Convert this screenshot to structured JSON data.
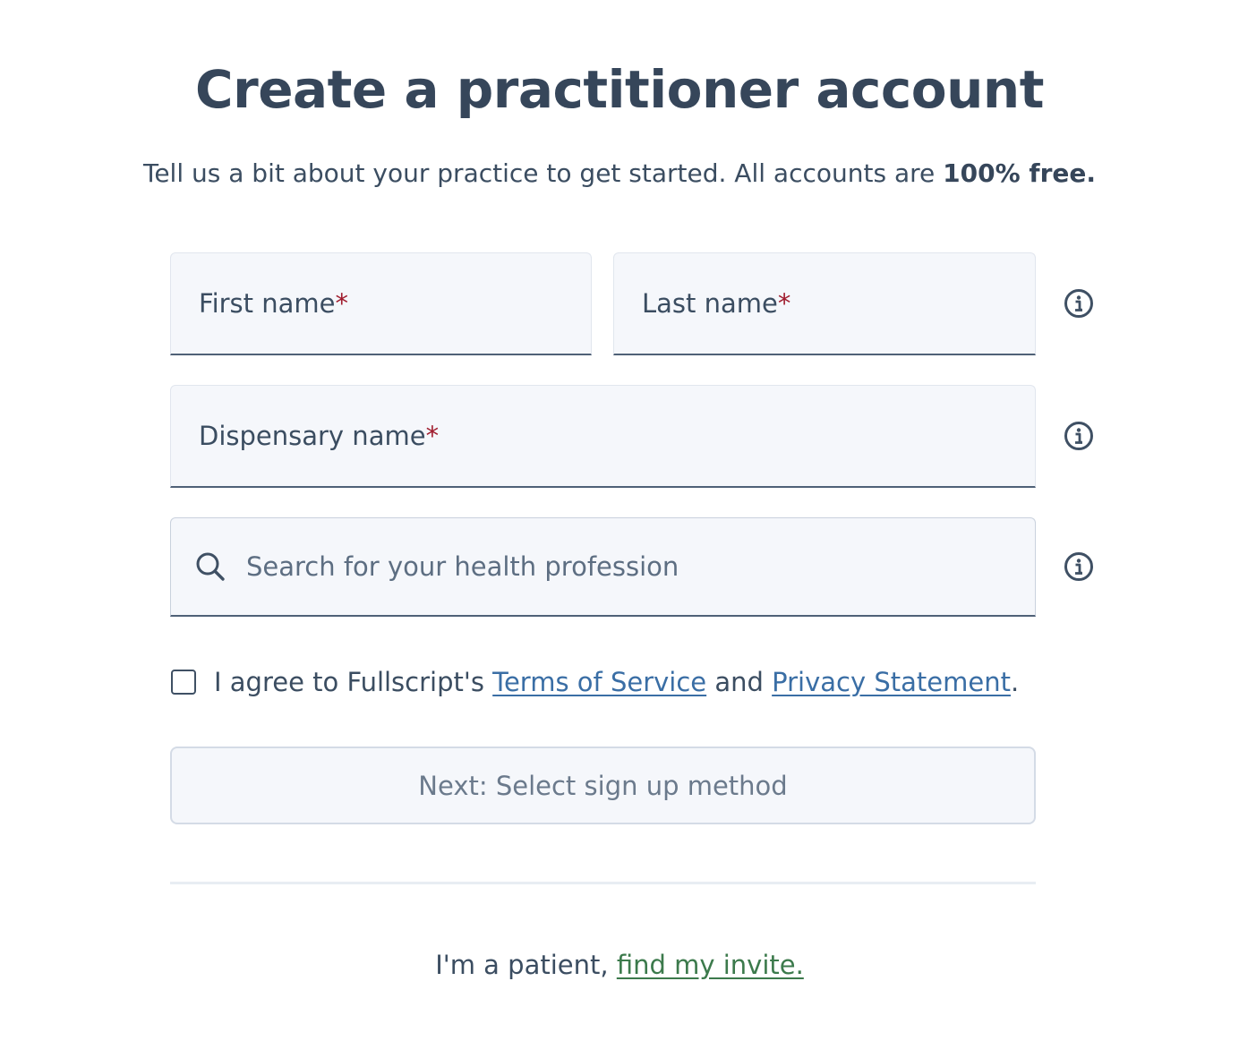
{
  "header": {
    "title": "Create a practitioner account",
    "subtitle_prefix": "Tell us a bit about your practice to get started. All accounts are ",
    "subtitle_bold": "100% free."
  },
  "form": {
    "first_name": {
      "label": "First name",
      "required_mark": "*"
    },
    "last_name": {
      "label": "Last name",
      "required_mark": "*"
    },
    "dispensary_name": {
      "label": "Dispensary name",
      "required_mark": "*"
    },
    "profession_search": {
      "placeholder": "Search for your health profession"
    },
    "agreement": {
      "prefix": "I agree to Fullscript's ",
      "terms_link": "Terms of Service",
      "middle": " and ",
      "privacy_link": "Privacy Statement",
      "suffix": ".",
      "checked": false
    },
    "next_button_label": "Next: Select sign up method"
  },
  "footer": {
    "patient_prefix": "I'm a patient, ",
    "patient_link": "find my invite."
  },
  "icons": {
    "info": "info-circle-icon",
    "search": "search-icon"
  },
  "colors": {
    "text": "#36465a",
    "required": "#a01c2e",
    "link_blue": "#3a6ea5",
    "link_green": "#3c7a4c",
    "field_bg": "#f5f7fb"
  }
}
